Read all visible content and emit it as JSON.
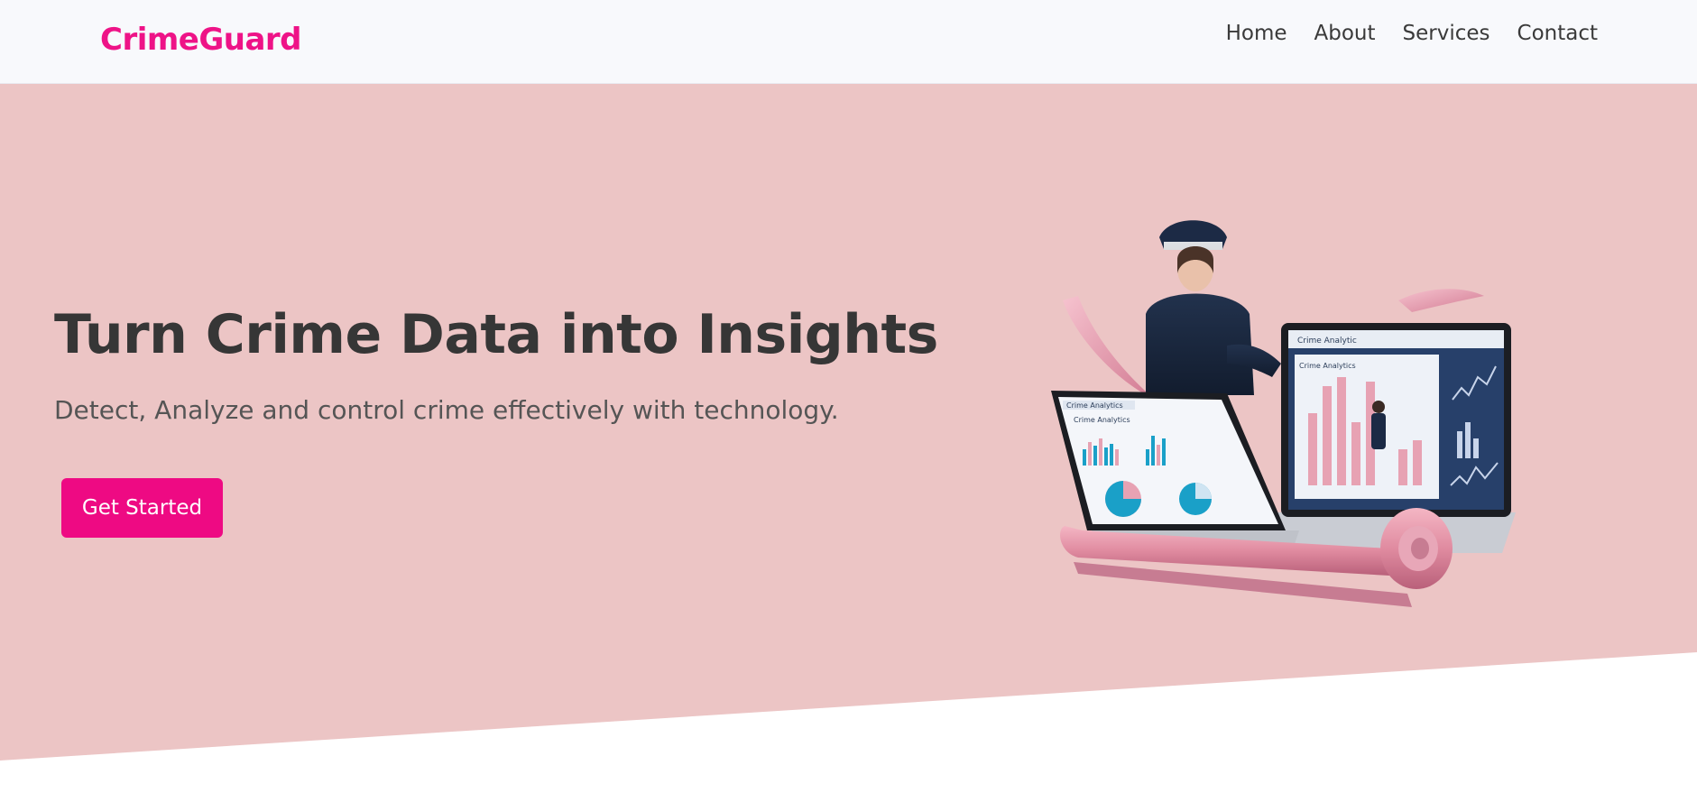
{
  "navbar": {
    "brand": "CrimeGuard",
    "links": [
      "Home",
      "About",
      "Services",
      "Contact"
    ]
  },
  "hero": {
    "headline": "Turn Crime Data into Insights",
    "subheadline": "Detect, Analyze and control crime effectively with technology.",
    "cta_label": "Get Started"
  },
  "illustration": {
    "left_screen_title": "Crime Analytics",
    "left_screen_heading": "Crime Analytics",
    "right_screen_title": "Crime Analytic",
    "right_screen_heading": "Crime Analytics"
  },
  "colors": {
    "brand": "#ee1387",
    "cta": "#ee0a83",
    "hero_bg": "#ecc5c5",
    "navbar_bg": "#f8f9fc",
    "text_dark": "#363636"
  }
}
